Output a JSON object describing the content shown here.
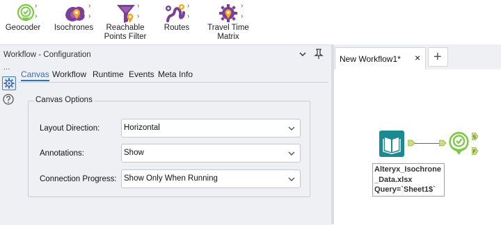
{
  "ribbon": {
    "tools": [
      {
        "name": "Geocoder",
        "lines": [
          "Geocoder"
        ],
        "icon": "geocoder-pin-icon",
        "color": "#7ac943"
      },
      {
        "name": "Isochrones",
        "lines": [
          "Isochrones"
        ],
        "icon": "isochrones-icon",
        "color": "#7b3f98"
      },
      {
        "name": "Reachable Points Filter",
        "lines": [
          "Reachable",
          "Points Filter"
        ],
        "icon": "reachable-points-filter-icon",
        "color": "#7b3f98"
      },
      {
        "name": "Routes",
        "lines": [
          "Routes"
        ],
        "icon": "routes-icon",
        "color": "#7b3f98"
      },
      {
        "name": "Travel Time Matrix",
        "lines": [
          "Travel Time",
          "Matrix"
        ],
        "icon": "travel-time-matrix-icon",
        "color": "#7b3f98"
      }
    ]
  },
  "config": {
    "title": "Workflow - Configuration",
    "dots": "...",
    "tabs": [
      "Canvas",
      "Workflow",
      "Runtime",
      "Events",
      "Meta Info"
    ],
    "active_tab": "Canvas",
    "group_title": "Canvas Options",
    "fields": [
      {
        "label": "Layout Direction:",
        "value": "Horizontal"
      },
      {
        "label": "Annotations:",
        "value": "Show"
      },
      {
        "label": "Connection Progress:",
        "value": "Show Only When Running"
      }
    ]
  },
  "canvas": {
    "tab_title": "New Workflow1*",
    "tab_close": "×",
    "add_tab": "+",
    "input_caption": [
      "Alteryx_Isochrone",
      "_Data.xlsx",
      "Query=`Sheet1$`"
    ],
    "anchor_s": "S",
    "anchor_f": "F"
  },
  "colors": {
    "accent": "#2f6fc0",
    "input_tool": "#1b8a92",
    "geocoder_green": "#7ac943",
    "location_purple": "#7b3f98"
  }
}
